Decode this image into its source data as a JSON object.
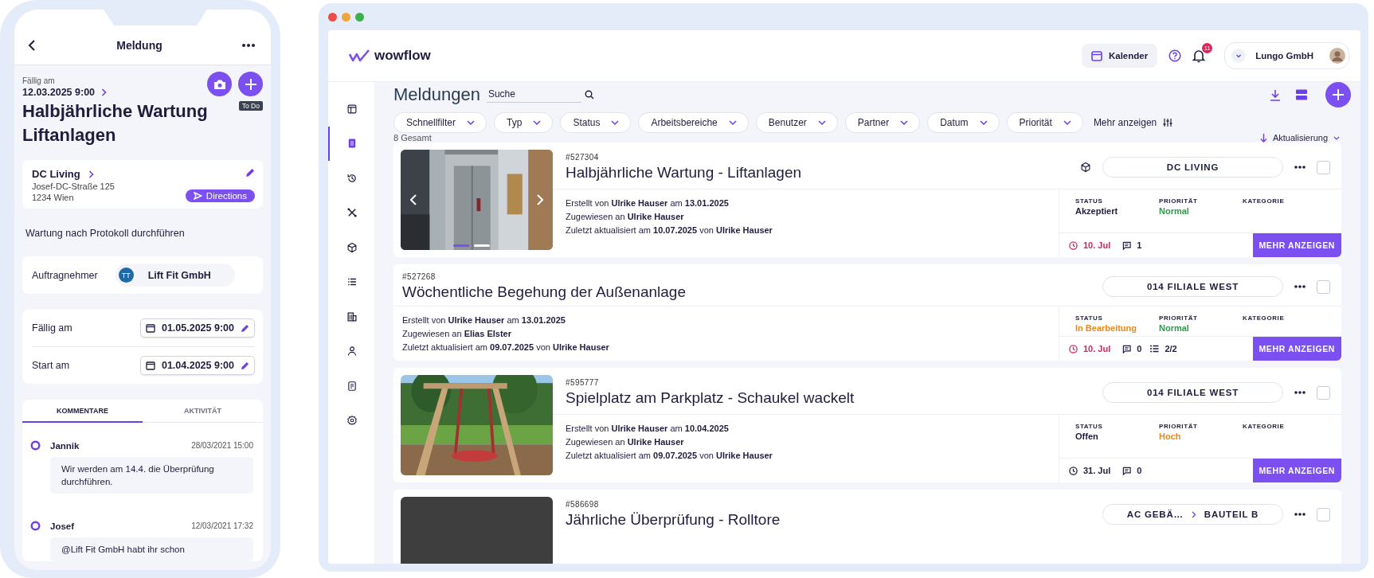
{
  "phone": {
    "title": "Meldung",
    "due_label": "Fällig am",
    "due_value": "12.03.2025 9:00",
    "status_badge": "To Do",
    "heading": "Halbjährliche Wartung Liftanlagen",
    "location": {
      "name": "DC Living",
      "street": "Josef-DC-Straße 125",
      "city": "1234 Wien",
      "directions": "Directions"
    },
    "description": "Wartung nach Protokoll durchführen",
    "contractor": {
      "label": "Auftragnehmer",
      "initials": "TT",
      "name": "Lift Fit GmbH"
    },
    "dates": [
      {
        "label": "Fällig am",
        "value": "01.05.2025 9:00"
      },
      {
        "label": "Start am",
        "value": "01.04.2025 9:00"
      }
    ],
    "tabs": [
      {
        "label": "KOMMENTARE",
        "selected": true
      },
      {
        "label": "AKTIVITÄT",
        "selected": false
      }
    ],
    "comments": [
      {
        "author": "Jannik",
        "time": "28/03/2021 15:00",
        "text": "Wir werden am 14.4. die Überprüfung durchführen."
      },
      {
        "author": "Josef",
        "time": "12/03/2021 17:32",
        "text": "@Lift Fit GmbH habt ihr schon"
      }
    ]
  },
  "desktop": {
    "logo": "wowflow",
    "calendar_button": "Kalender",
    "notification_count": "11",
    "account": "Lungo GmbH",
    "sidebar": [
      {
        "selected": false
      },
      {
        "selected": true
      },
      {
        "selected": false
      },
      {
        "selected": false
      },
      {
        "selected": false
      },
      {
        "selected": false
      },
      {
        "selected": false
      },
      {
        "selected": false
      },
      {
        "selected": false
      },
      {
        "selected": false
      }
    ],
    "page_title": "Meldungen",
    "search": {
      "placeholder": "Suche"
    },
    "filters": [
      "Schnellfilter",
      "Typ",
      "Status",
      "Arbeitsbereiche",
      "Benutzer",
      "Partner",
      "Datum",
      "Priorität"
    ],
    "more_filters": "Mehr anzeigen",
    "total": "8 Gesamt",
    "sort": "Aktualisierung",
    "cards": [
      {
        "kind": "carousel",
        "id": "#527304",
        "title": "Halbjährliche Wartung - Liftanlagen",
        "asset": true,
        "location": [
          "DC LIVING"
        ],
        "checked": false,
        "meta": [
          "Erstellt von **Ulrike Hauser** am **13.01.2025**",
          "Zugewiesen an **Ulrike Hauser**",
          "Zuletzt aktualisiert am **10.07.2025** von **Ulrike Hauser**"
        ],
        "fields": [
          {
            "label": "STATUS",
            "value": "Akzeptiert",
            "color": "#1f1d3d"
          },
          {
            "label": "PRIORITÄT",
            "value": "Normal",
            "color": "#2e9a4a"
          },
          {
            "label": "KATEGORIE"
          }
        ],
        "due": "10. Jul",
        "overdue": true,
        "comments": "1",
        "button": "MEHR ANZEIGEN"
      },
      {
        "kind": "plain",
        "id": "#527268",
        "title": "Wöchentliche Begehung der Außenanlage",
        "asset": false,
        "location": [
          "014 FILIALE WEST"
        ],
        "checked": false,
        "meta": [
          "Erstellt von **Ulrike Hauser** am **13.01.2025**",
          "Zugewiesen an **Elias Elster**",
          "Zuletzt aktualisiert am **09.07.2025** von **Ulrike Hauser**"
        ],
        "fields": [
          {
            "label": "STATUS",
            "value": "In Bearbeitung",
            "color": "#e8891c"
          },
          {
            "label": "PRIORITÄT",
            "value": "Normal",
            "color": "#2e9a4a"
          },
          {
            "label": "KATEGORIE"
          }
        ],
        "due": "10. Jul",
        "overdue": true,
        "comments": "0",
        "checklist": "2/2",
        "button": "MEHR ANZEIGEN"
      },
      {
        "kind": "picture",
        "id": "#595777",
        "title": "Spielplatz am Parkplatz - Schaukel wackelt",
        "asset": false,
        "location": [
          "014 FILIALE WEST"
        ],
        "checked": false,
        "meta": [
          "Erstellt von **Ulrike Hauser** am **10.04.2025**",
          "Zugewiesen an **Ulrike Hauser**",
          "Zuletzt aktualisiert am **09.07.2025** von **Ulrike Hauser**"
        ],
        "fields": [
          {
            "label": "STATUS",
            "value": "Offen",
            "color": "#1f1d3d"
          },
          {
            "label": "PRIORITÄT",
            "value": "Hoch",
            "color": "#e8891c"
          },
          {
            "label": "KATEGORIE"
          }
        ],
        "due": "31. Jul",
        "overdue": false,
        "comments": "0",
        "button": "MEHR ANZEIGEN"
      },
      {
        "kind": "placeholder",
        "id": "#586698",
        "title": "Jährliche Überprüfung - Rolltore",
        "asset": false,
        "location": [
          "AC GEBÄ…",
          "BAUTEIL B"
        ],
        "checked": false
      }
    ]
  }
}
